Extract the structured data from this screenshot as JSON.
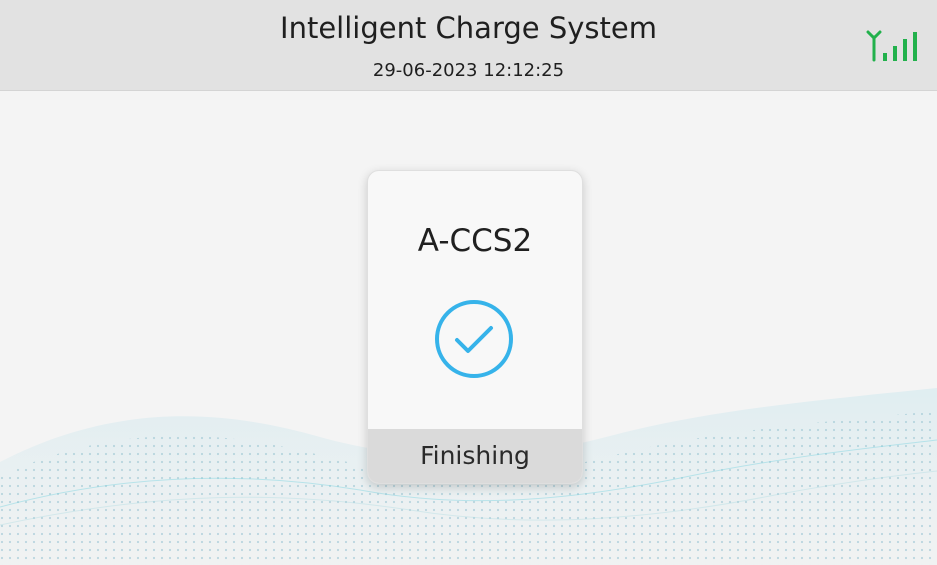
{
  "header": {
    "title": "Intelligent Charge System",
    "datetime": "29-06-2023 12:12:25",
    "signal_icon": "antenna-signal-icon",
    "signal_strength": 4,
    "signal_color": "#22b14c"
  },
  "connector": {
    "name": "A-CCS2",
    "status_icon": "check-circle-icon",
    "status_color": "#36b3ea",
    "status": "Finishing"
  }
}
